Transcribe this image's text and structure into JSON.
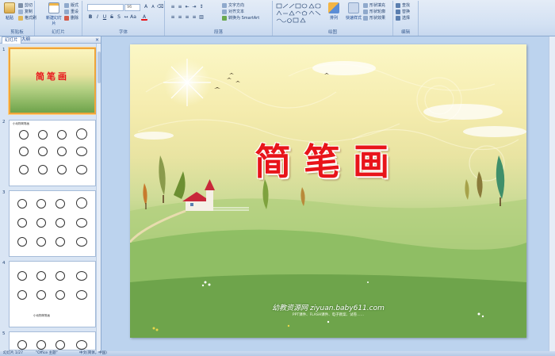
{
  "ribbon": {
    "clipboard": {
      "label": "剪贴板",
      "paste": "粘贴",
      "cut": "剪切",
      "copy": "复制",
      "format_painter": "格式刷"
    },
    "slides": {
      "label": "幻灯片",
      "new_slide": "新建幻灯片",
      "layout": "版式",
      "reset": "重设",
      "delete": "删除"
    },
    "font": {
      "label": "字体",
      "font_size": "96"
    },
    "paragraph": {
      "label": "段落",
      "text_direction": "文字方向",
      "align_text": "对齐文本",
      "smartart": "转换为 SmartArt"
    },
    "drawing": {
      "label": "绘图",
      "arrange": "排列",
      "quick_styles": "快速样式",
      "shape_fill": "形状填充",
      "shape_outline": "形状轮廓",
      "shape_effects": "形状效果"
    },
    "editing": {
      "label": "编辑",
      "find": "查找",
      "replace": "替换",
      "select": "选择"
    }
  },
  "panel": {
    "tab_slides": "幻灯片",
    "tab_outline": "大纲",
    "close": "×",
    "thumbnails": [
      {
        "number": "1",
        "title": "简笔画"
      },
      {
        "number": "2",
        "caption": "小动物简笔画"
      },
      {
        "number": "3"
      },
      {
        "number": "4",
        "caption": "小动物简笔画"
      },
      {
        "number": "5"
      }
    ]
  },
  "slide": {
    "title": "简笔画",
    "watermark": "幼教资源网 ziyuan.baby611.com",
    "watermark_sub": "PPT课件、FLASH课件、电子教案、试卷……"
  },
  "status": {
    "slide_info": "幻灯片 1/27",
    "theme": "\"Office 主题\"",
    "language": "中文(简体，中国)"
  },
  "colors": {
    "title_red": "#e8141a",
    "selection": "#f0a53a",
    "ribbon": "#d3e1f3"
  }
}
